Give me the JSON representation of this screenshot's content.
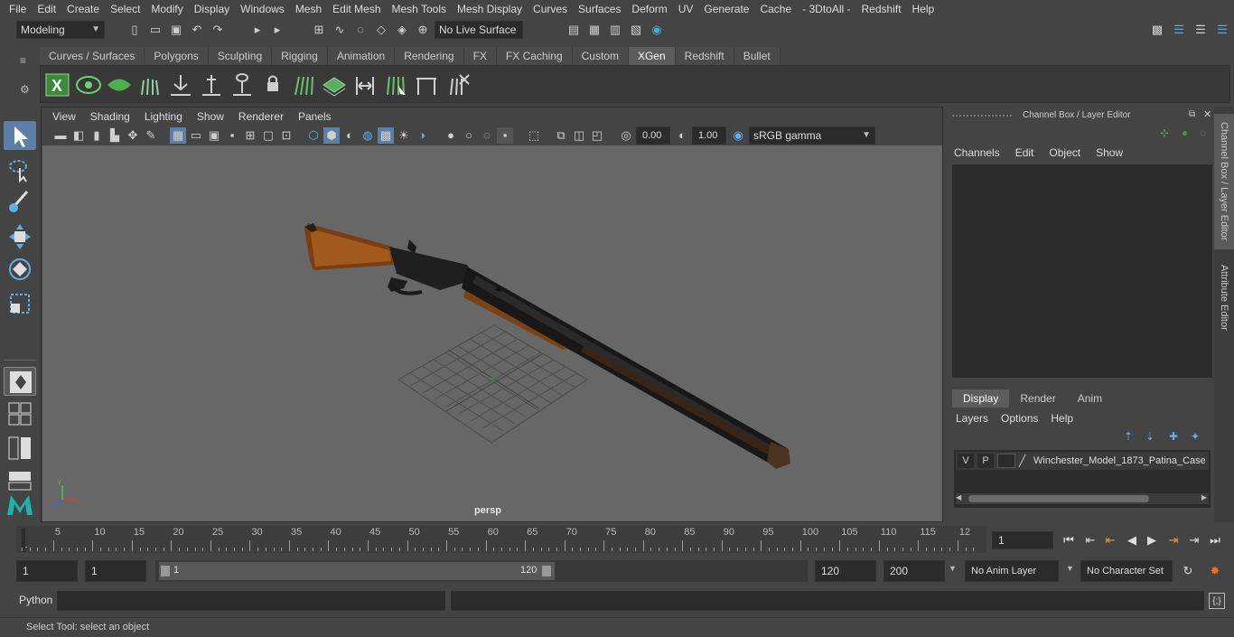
{
  "menubar": [
    "File",
    "Edit",
    "Create",
    "Select",
    "Modify",
    "Display",
    "Windows",
    "Mesh",
    "Edit Mesh",
    "Mesh Tools",
    "Mesh Display",
    "Curves",
    "Surfaces",
    "Deform",
    "UV",
    "Generate",
    "Cache",
    "- 3DtoAll -",
    "Redshift",
    "Help"
  ],
  "status_line": {
    "mode": "Modeling",
    "live_surface": "No Live Surface"
  },
  "shelf_tabs": [
    "Curves / Surfaces",
    "Polygons",
    "Sculpting",
    "Rigging",
    "Animation",
    "Rendering",
    "FX",
    "FX Caching",
    "Custom",
    "XGen",
    "Redshift",
    "Bullet"
  ],
  "active_shelf_tab": "XGen",
  "viewport": {
    "menu": [
      "View",
      "Shading",
      "Lighting",
      "Show",
      "Renderer",
      "Panels"
    ],
    "exposure": "0.00",
    "gamma": "1.00",
    "color_space": "sRGB gamma",
    "camera_label": "persp"
  },
  "channel_box": {
    "title": "Channel Box / Layer Editor",
    "menu": [
      "Channels",
      "Edit",
      "Object",
      "Show"
    ]
  },
  "layer_editor": {
    "tabs": [
      "Display",
      "Render",
      "Anim"
    ],
    "active_tab": "Display",
    "menu": [
      "Layers",
      "Options",
      "Help"
    ],
    "layers": [
      {
        "v": "V",
        "p": "P",
        "name": "Winchester_Model_1873_Patina_Case"
      }
    ]
  },
  "side_tabs": [
    "Channel Box / Layer Editor",
    "Attribute Editor"
  ],
  "timeline": {
    "ticks": [
      "5",
      "10",
      "15",
      "20",
      "25",
      "30",
      "35",
      "40",
      "45",
      "50",
      "55",
      "60",
      "65",
      "70",
      "75",
      "80",
      "85",
      "90",
      "95",
      "100",
      "105",
      "110",
      "115",
      "12"
    ],
    "start_label": "1",
    "current_frame": "1"
  },
  "range_bar": {
    "start": "1",
    "playback_start": "1",
    "slider_start": "1",
    "slider_end": "120",
    "playback_end": "120",
    "end": "200",
    "anim_layer": "No Anim Layer",
    "character_set": "No Character Set"
  },
  "command_line": {
    "label": "Python"
  },
  "help_line": "Select Tool: select an object"
}
